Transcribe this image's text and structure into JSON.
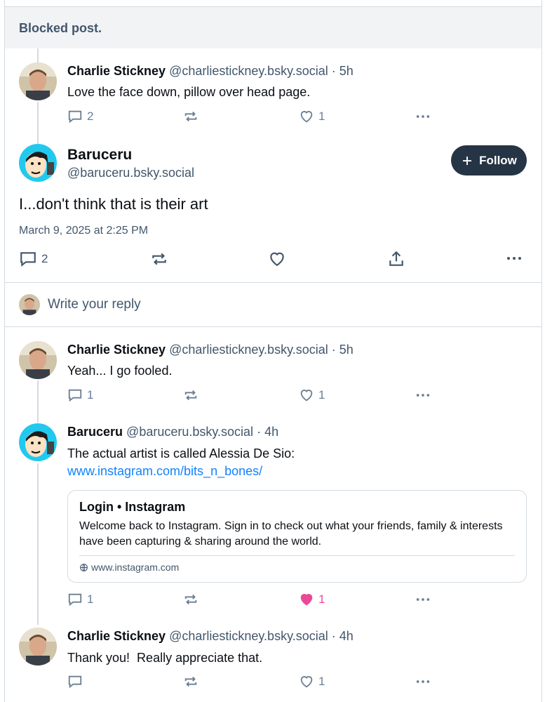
{
  "blocked_label": "Blocked post.",
  "posts": [
    {
      "author": "Charlie Stickney",
      "handle": "@charliestickney.bsky.social",
      "time": "· 5h",
      "text": "Love the face down, pillow over head page.",
      "replies": "2",
      "likes": "1"
    },
    {
      "author": "Charlie Stickney",
      "handle": "@charliestickney.bsky.social",
      "time": "· 5h",
      "text": "Yeah... I go fooled.",
      "replies": "1",
      "likes": "1"
    },
    {
      "author": "Baruceru",
      "handle": "@baruceru.bsky.social",
      "time": "· 4h",
      "text": "The actual artist is called Alessia De Sio:",
      "link": "www.instagram.com/bits_n_bones/",
      "replies": "1",
      "likes": "1",
      "liked_color": "#ec4899"
    },
    {
      "author": "Charlie Stickney",
      "handle": "@charliestickney.bsky.social",
      "time": "· 4h",
      "text": "Thank you!  Really appreciate that.",
      "likes": "1"
    }
  ],
  "focused": {
    "author": "Baruceru",
    "handle": "@baruceru.bsky.social",
    "text": "I...don't think that is their art",
    "date": "March 9, 2025 at 2:25 PM",
    "replies": "2",
    "follow_label": "Follow"
  },
  "reply_placeholder": "Write your reply",
  "link_card": {
    "title": "Login • Instagram",
    "description": "Welcome back to Instagram. Sign in to check out what your friends, family & interests have been capturing & sharing around the world.",
    "domain": "www.instagram.com"
  },
  "icons": [
    "reply-icon",
    "repost-icon",
    "heart-icon",
    "more-icon",
    "share-icon",
    "plus-icon",
    "globe-icon"
  ],
  "colors": {
    "accent": "#1083fe",
    "follow_bg": "#263545",
    "muted": "#42576c",
    "like": "#ec4899"
  }
}
